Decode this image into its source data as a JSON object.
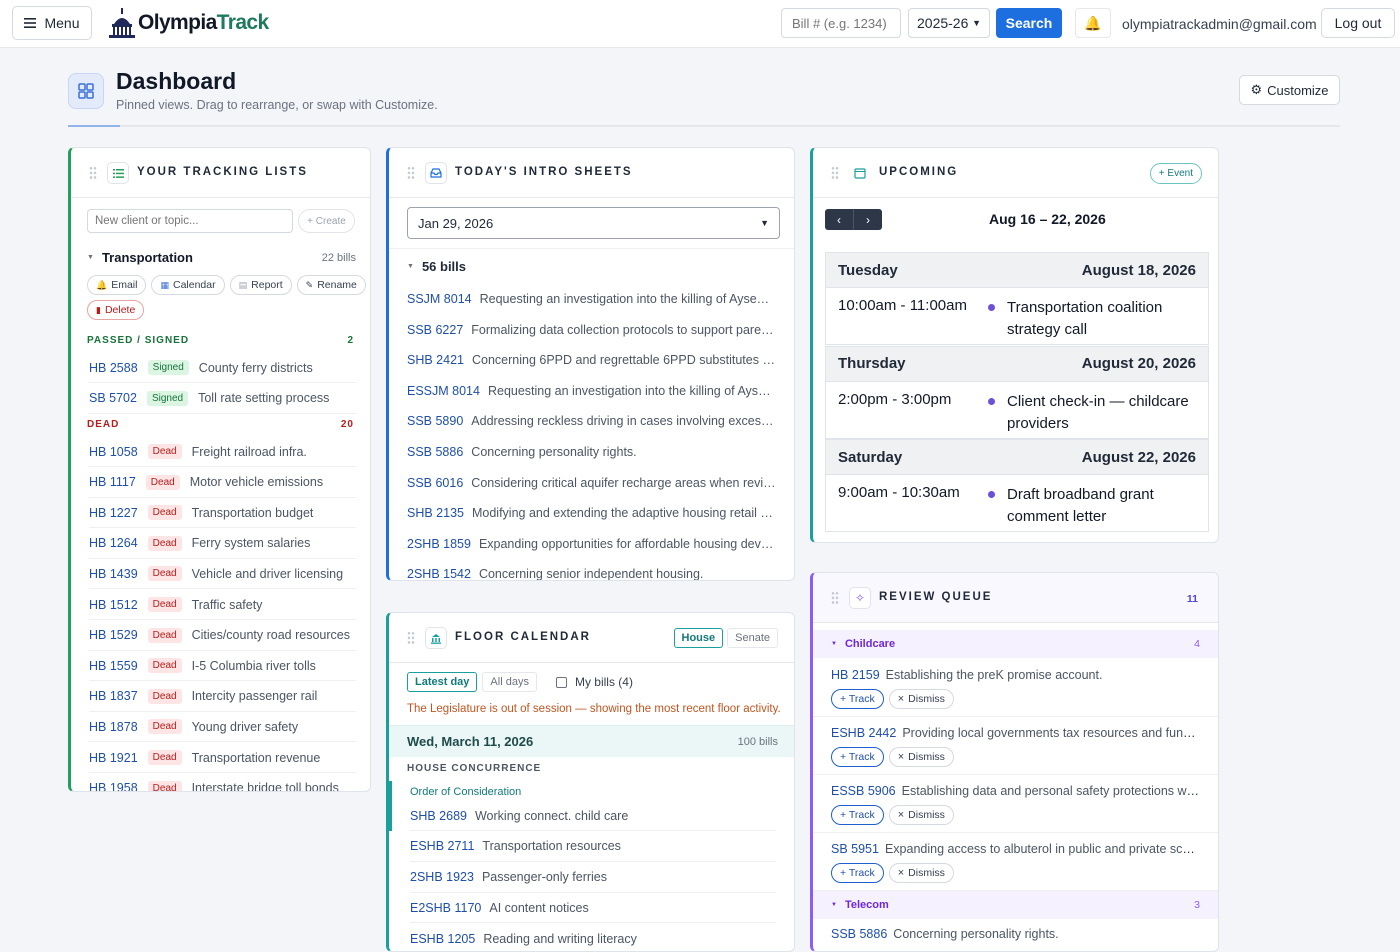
{
  "nav": {
    "menu_label": "Menu",
    "logo_a": "Olympia",
    "logo_b": "Track",
    "bill_placeholder": "Bill # (e.g. 1234)",
    "session": "2025-26",
    "search_label": "Search",
    "user_email": "olympiatrackadmin@gmail.com",
    "logout_label": "Log out"
  },
  "dashboard": {
    "title": "Dashboard",
    "subtitle": "Pinned views. Drag to rearrange, or swap with Customize.",
    "customize_label": "Customize"
  },
  "tracking": {
    "title": "YOUR TRACKING LISTS",
    "new_placeholder": "New client or topic...",
    "create_label": "+ Create",
    "list_name": "Transportation",
    "list_count": "22 bills",
    "actions": [
      "Email",
      "Calendar",
      "Report",
      "Rename"
    ],
    "delete_label": "Delete",
    "passed_label": "PASSED / SIGNED",
    "passed_count": "2",
    "dead_label": "DEAD",
    "dead_count": "20",
    "passed": [
      {
        "num": "HB 2588",
        "tag": "Signed",
        "desc": "County ferry districts"
      },
      {
        "num": "SB 5702",
        "tag": "Signed",
        "desc": "Toll rate setting process"
      }
    ],
    "dead": [
      {
        "num": "HB 1058",
        "tag": "Dead",
        "desc": "Freight railroad infra."
      },
      {
        "num": "HB 1117",
        "tag": "Dead",
        "desc": "Motor vehicle emissions"
      },
      {
        "num": "HB 1227",
        "tag": "Dead",
        "desc": "Transportation budget"
      },
      {
        "num": "HB 1264",
        "tag": "Dead",
        "desc": "Ferry system salaries"
      },
      {
        "num": "HB 1439",
        "tag": "Dead",
        "desc": "Vehicle and driver licensing"
      },
      {
        "num": "HB 1512",
        "tag": "Dead",
        "desc": "Traffic safety"
      },
      {
        "num": "HB 1529",
        "tag": "Dead",
        "desc": "Cities/county road resources"
      },
      {
        "num": "HB 1559",
        "tag": "Dead",
        "desc": "I-5 Columbia river tolls"
      },
      {
        "num": "HB 1837",
        "tag": "Dead",
        "desc": "Intercity passenger rail"
      },
      {
        "num": "HB 1878",
        "tag": "Dead",
        "desc": "Young driver safety"
      },
      {
        "num": "HB 1921",
        "tag": "Dead",
        "desc": "Transportation revenue"
      },
      {
        "num": "HB 1958",
        "tag": "Dead",
        "desc": "Interstate bridge toll bonds"
      }
    ]
  },
  "intro": {
    "title": "TODAY'S INTRO SHEETS",
    "date": "Jan 29, 2026",
    "count_label": "56 bills",
    "bills": [
      {
        "num": "SSJM 8014",
        "desc": "Requesting an investigation into the killing of Aysenur E..."
      },
      {
        "num": "SSB 6227",
        "desc": "Formalizing data collection protocols to support parentin..."
      },
      {
        "num": "SHB 2421",
        "desc": "Concerning 6PPD and regrettable 6PPD substitutes in tires."
      },
      {
        "num": "ESSJM 8014",
        "desc": "Requesting an investigation into the killing of Aysenur ..."
      },
      {
        "num": "SSB 5890",
        "desc": "Addressing reckless driving in cases involving excessive s..."
      },
      {
        "num": "SSB 5886",
        "desc": "Concerning personality rights."
      },
      {
        "num": "SSB 6016",
        "desc": "Considering critical aquifer recharge areas when revising a..."
      },
      {
        "num": "SHB 2135",
        "desc": "Modifying and extending the adaptive housing retail sale..."
      },
      {
        "num": "2SHB 1859",
        "desc": "Expanding opportunities for affordable housing develop..."
      },
      {
        "num": "2SHB 1542",
        "desc": "Concerning senior independent housing."
      }
    ]
  },
  "floor": {
    "title": "FLOOR CALENDAR",
    "chambers": [
      "House",
      "Senate"
    ],
    "filters": [
      "Latest day",
      "All days"
    ],
    "my_bills": "My bills (4)",
    "notice": "The Legislature is out of session — showing the most recent floor activity.",
    "day": "Wed, March 11, 2026",
    "day_count": "100 bills",
    "section": "HOUSE CONCURRENCE",
    "subsection": "Order of Consideration",
    "bills": [
      {
        "num": "SHB 2689",
        "desc": "Working connect. child care"
      },
      {
        "num": "ESHB 2711",
        "desc": "Transportation resources"
      },
      {
        "num": "2SHB 1923",
        "desc": "Passenger-only ferries"
      },
      {
        "num": "E2SHB 1170",
        "desc": "AI content notices"
      },
      {
        "num": "ESHB 1205",
        "desc": "Reading and writing literacy"
      }
    ]
  },
  "upcoming": {
    "title": "UPCOMING",
    "event_label": "+ Event",
    "range": "Aug 16 – 22, 2026",
    "days": [
      {
        "weekday": "Tuesday",
        "date": "August 18, 2026",
        "time": "10:00am - 11:00am",
        "event": "Transportation coalition strategy call"
      },
      {
        "weekday": "Thursday",
        "date": "August 20, 2026",
        "time": "2:00pm - 3:00pm",
        "event": "Client check-in — childcare providers"
      },
      {
        "weekday": "Saturday",
        "date": "August 22, 2026",
        "time": "9:00am - 10:30am",
        "event": "Draft broadband grant comment letter"
      }
    ]
  },
  "review": {
    "title": "REVIEW QUEUE",
    "count": "11",
    "group1": "Childcare",
    "group1_count": "4",
    "group2": "Telecom",
    "group2_count": "3",
    "track_label": "+ Track",
    "dismiss_label": "Dismiss",
    "items": [
      {
        "num": "HB 2159",
        "desc": "Establishing the preK promise account."
      },
      {
        "num": "ESHB 2442",
        "desc": "Providing local governments tax resources and fund flexi..."
      },
      {
        "num": "ESSB 5906",
        "desc": "Establishing data and personal safety protections within ar..."
      },
      {
        "num": "SB 5951",
        "desc": "Expanding access to albuterol in public and private schools."
      }
    ],
    "telecom_first": {
      "num": "SSB 5886",
      "desc": "Concerning personality rights."
    }
  },
  "colors": {
    "green": "#22a05b",
    "blue": "#1d6fe0",
    "teal": "#1a9e9e",
    "purple": "#8b5cf6"
  }
}
